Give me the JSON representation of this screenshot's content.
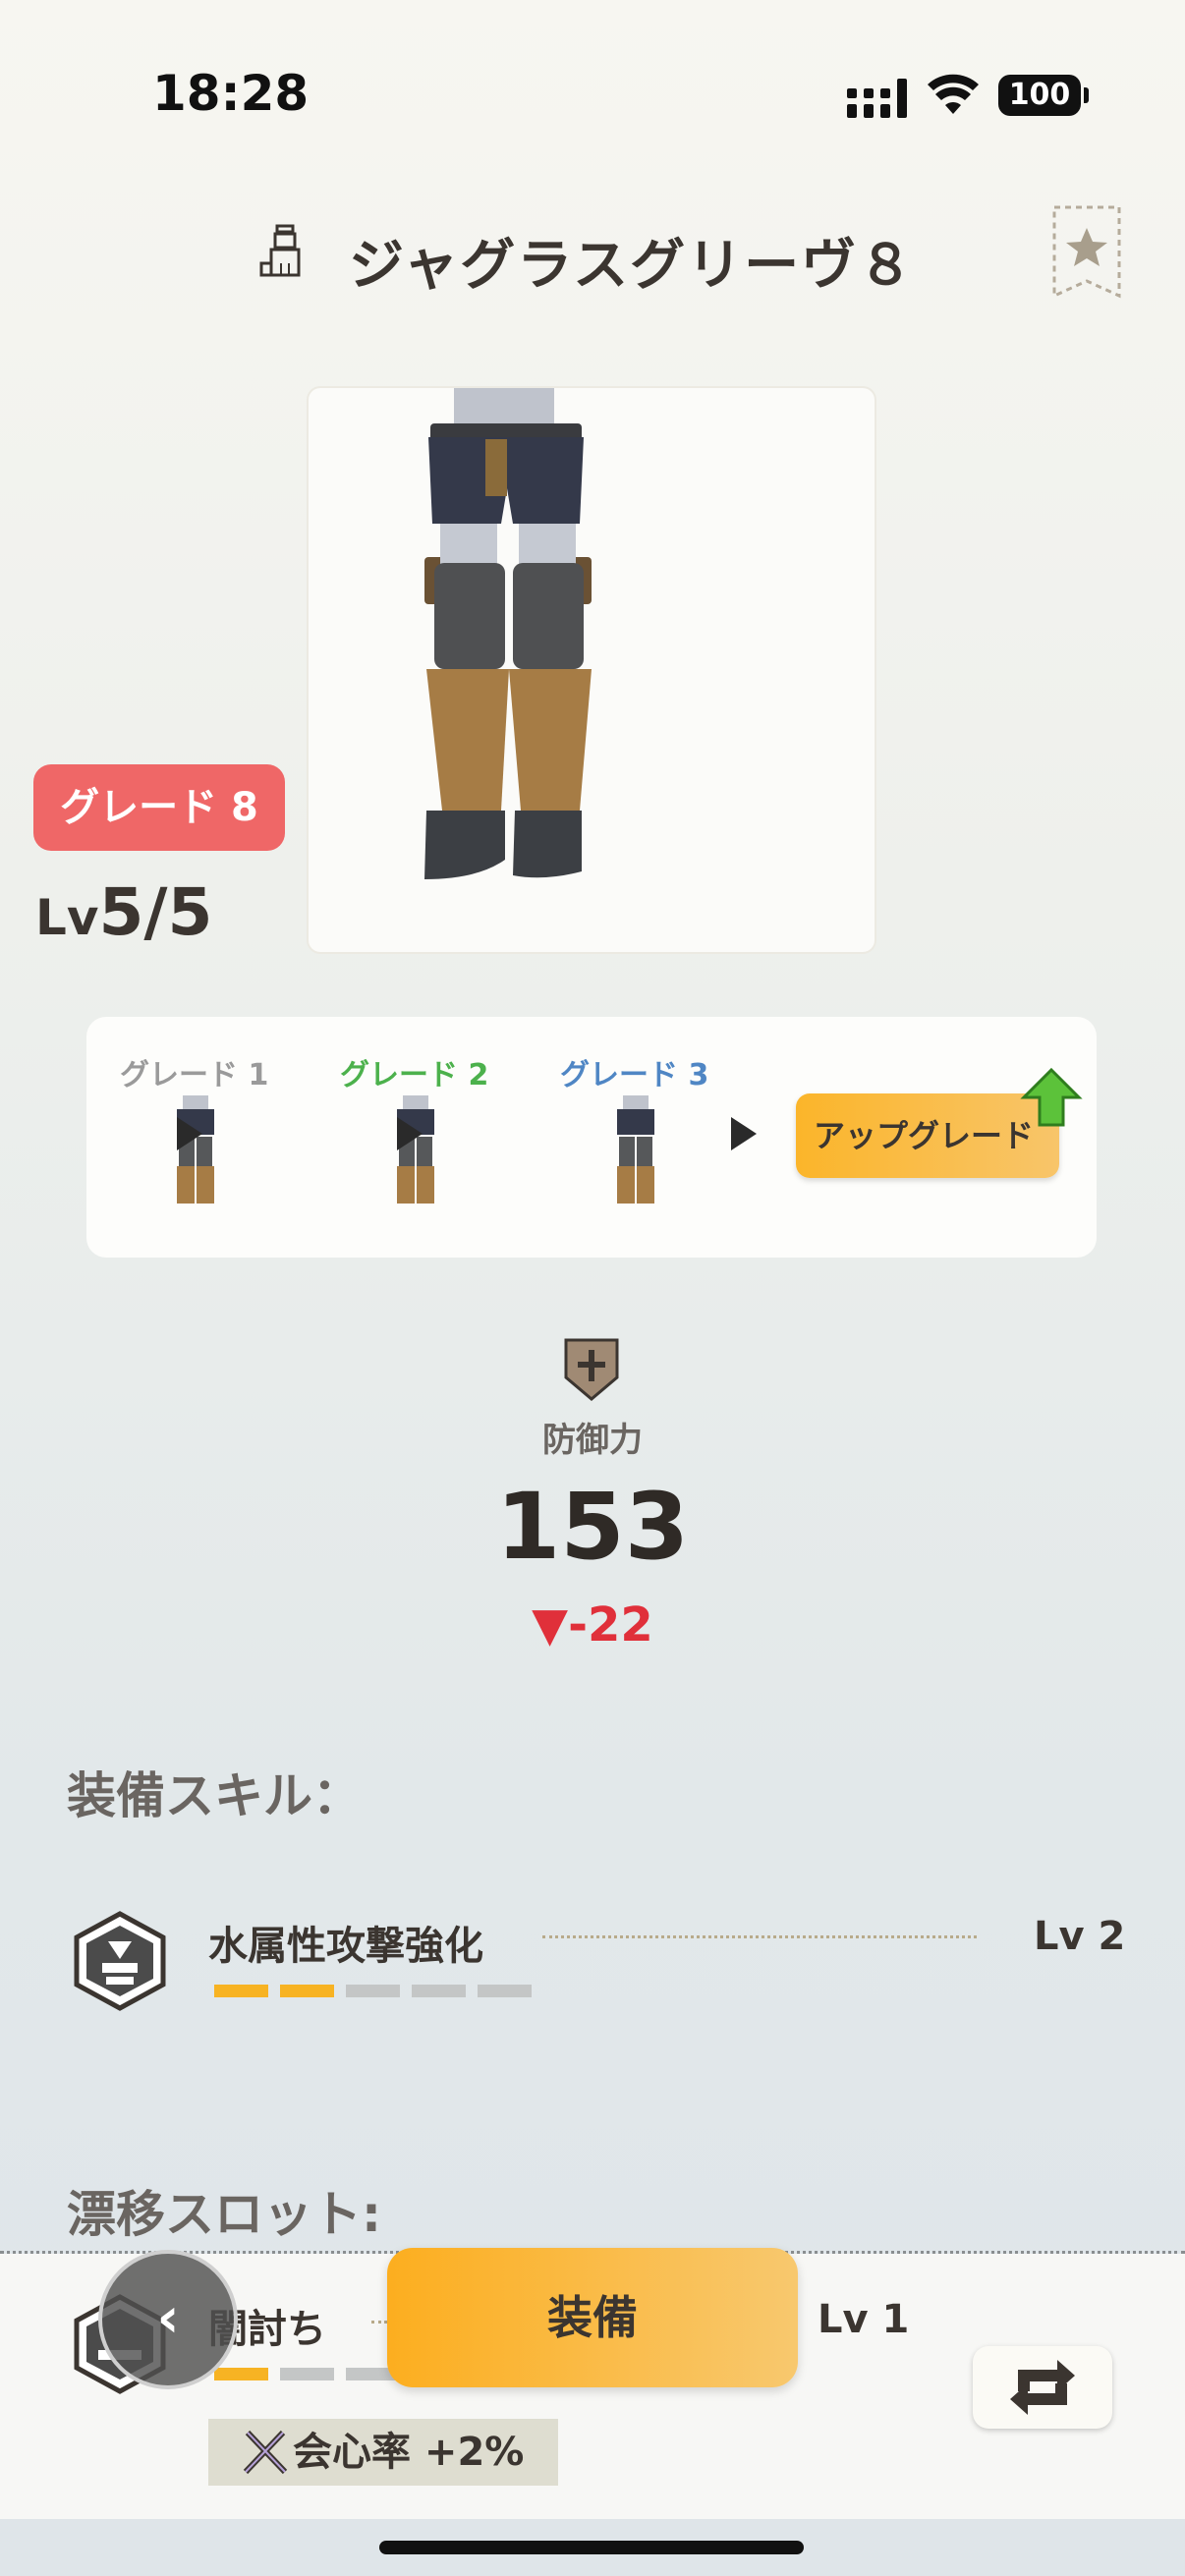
{
  "status": {
    "time": "18:28",
    "battery": "100",
    "signal_icon": "signal-icon",
    "wifi_icon": "wifi-icon"
  },
  "header": {
    "title": "ジャグラスグリーヴ８",
    "category_icon": "leg-armor-icon",
    "bookmark_icon": "star-bookmark-icon"
  },
  "item": {
    "grade_badge": "グレード 8",
    "level_prefix": "Lv",
    "level_value": "5/5"
  },
  "upgrade": {
    "steps": [
      {
        "label": "グレード 1",
        "color": "#9a9a9a"
      },
      {
        "label": "グレード 2",
        "color": "#4cb14c"
      },
      {
        "label": "グレード 3",
        "color": "#4f86c4"
      }
    ],
    "button_label": "アップグレード",
    "button_icon": "upgrade-arrow-icon"
  },
  "defense": {
    "label": "防御力",
    "value": "153",
    "diff": "▼-22",
    "icon": "shield-icon"
  },
  "equip_skills": {
    "label": "装備スキル：",
    "items": [
      {
        "name": "水属性攻撃強化",
        "level": "Lv 2",
        "pips_filled": 2,
        "pips_total": 5,
        "icon": "water-attack-skill-icon"
      }
    ]
  },
  "drift_slots": {
    "label": "漂移スロット:",
    "items": [
      {
        "name": "闇討ち",
        "level": "Lv 1",
        "pips_filled": 1,
        "pips_total": 3,
        "icon": "ambush-skill-icon",
        "perk": "会心率 +2%",
        "perk_icon": "crossed-swords-icon"
      }
    ]
  },
  "actions": {
    "back_label": "‹",
    "equip_label": "装備",
    "swap_icon": "swap-icon"
  },
  "colors": {
    "accent_orange": "#fbb52a",
    "grade_red": "#ef6767",
    "diff_red": "#e0303a"
  }
}
